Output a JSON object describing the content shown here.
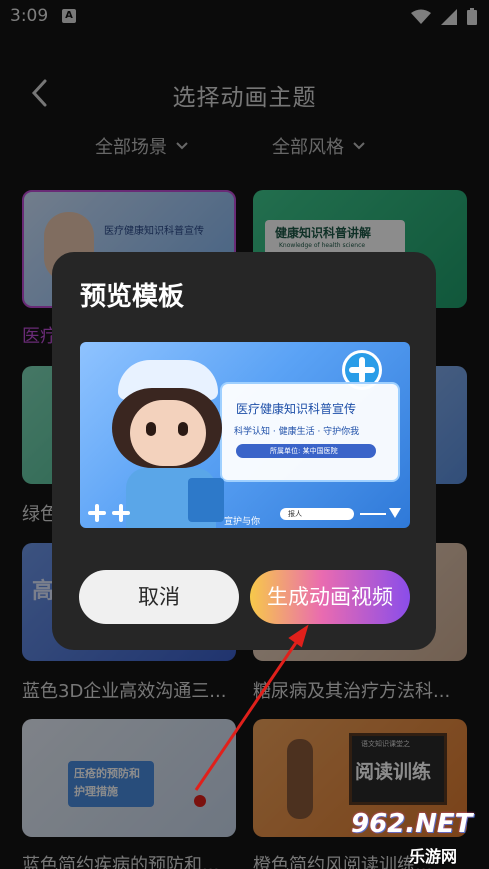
{
  "status_bar": {
    "time": "3:09",
    "notification_badge": "A"
  },
  "header": {
    "title": "选择动画主题"
  },
  "filters": {
    "scene": "全部场景",
    "style": "全部风格"
  },
  "grid": {
    "labels": [
      "医疗",
      "绿色",
      "蓝色3D企业高效沟通三...",
      "糖尿病及其治疗方法科...",
      "蓝色简约疾病的预防和...",
      "橙色简约风阅读训练..."
    ],
    "thumb_texts": {
      "health_science": "健康知识科普讲解",
      "health_science_en": "Knowledge of health science",
      "medical_card": "医疗健康知识科普宣传",
      "blue3d": "高",
      "pressure": "压疮的预防和护理措施",
      "reading": "阅读训练",
      "reading_top": "语文知识课堂之"
    }
  },
  "dialog": {
    "title": "预览模板",
    "preview": {
      "headline": "医疗健康知识科普宣传",
      "subline": "科学认知 · 健康生活 · 守护你我",
      "org": "所属单位: 某中国医院",
      "presenter": "报人",
      "caption": "宣护与你"
    },
    "cancel_label": "取消",
    "generate_label": "生成动画视频"
  },
  "watermark": {
    "text": "962.NET",
    "sub": "乐游网"
  },
  "colors": {
    "accent_pink": "#e96bb0",
    "accent_purple": "#8a4dea",
    "accent_yellow": "#f7c94a",
    "annotation": "#e0201b"
  }
}
